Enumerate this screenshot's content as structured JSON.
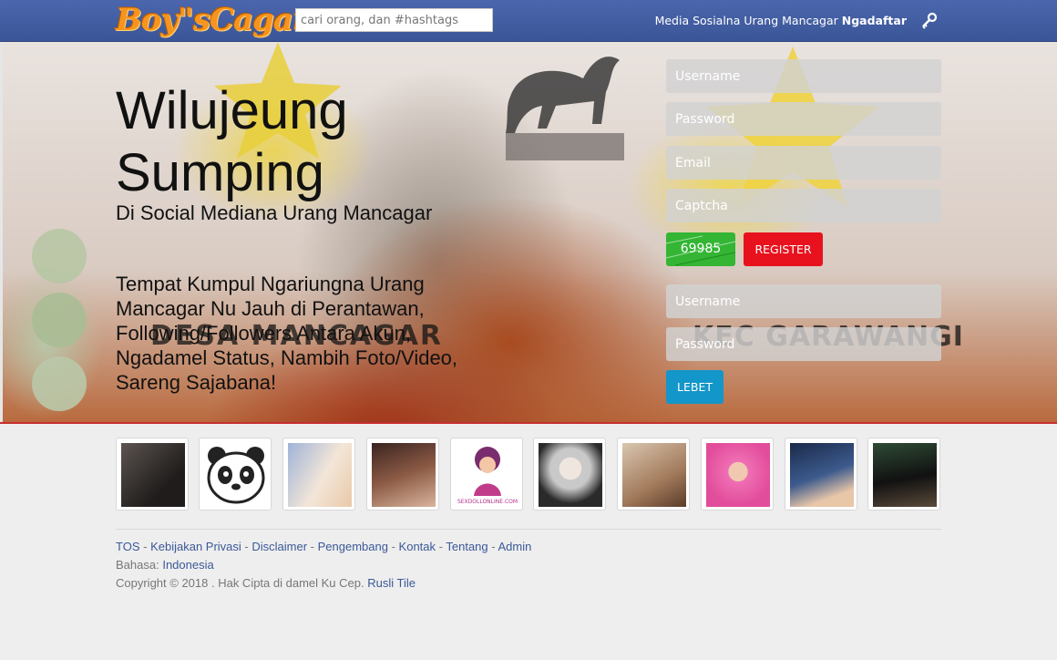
{
  "header": {
    "logo": "Boy\"sCagar",
    "search_placeholder": "cari orang, dan #hashtags",
    "tagline": "Media Sosialna Urang Mancagar",
    "signup_link": "Ngadaftar"
  },
  "hero": {
    "title_line1": "Wilujeung",
    "title_line2": "Sumping",
    "subtitle": "Di Social Mediana Urang Mancagar",
    "description": "Tempat Kumpul Ngariungna Urang Mancagar Nu Jauh di Perantawan, Following/Followers Antara Akun, Ngadamel Status, Nambih Foto/Video, Sareng Sajabana!",
    "banner_text_left": "DESA MANCAGAR",
    "banner_text_right": "KEC GARAWANGI"
  },
  "register": {
    "username_placeholder": "Username",
    "password_placeholder": "Password",
    "email_placeholder": "Email",
    "captcha_placeholder": "Captcha",
    "captcha_code": "69985",
    "register_button": "REGISTER"
  },
  "login": {
    "username_placeholder": "Username",
    "password_placeholder": "Password",
    "login_button": "LEBET"
  },
  "avatars": [
    {
      "label": "",
      "color": "#2d2a28"
    },
    {
      "label": "",
      "color": "#ffffff"
    },
    {
      "label": "",
      "color": "#c9d4ea"
    },
    {
      "label": "",
      "color": "#6b3b2a"
    },
    {
      "label": "SEXDOLLONLINE.COM",
      "color": "#ffffff"
    },
    {
      "label": "",
      "color": "#d8d8d8"
    },
    {
      "label": "",
      "color": "#b6906f"
    },
    {
      "label": "",
      "color": "#e35aa5"
    },
    {
      "label": "",
      "color": "#27365a"
    },
    {
      "label": "",
      "color": "#1d2a1e"
    }
  ],
  "footer": {
    "links": [
      "TOS",
      "Kebijakan Privasi",
      "Disclaimer",
      "Pengembang",
      "Kontak",
      "Tentang",
      "Admin"
    ],
    "language_label": "Bahasa:",
    "language_value": "Indonesia",
    "copyright": "Copyright © 2018 . Hak Cipta di damel Ku Cep.",
    "author": "Rusli Tile"
  },
  "colors": {
    "header_bg": "#3f5a9c",
    "captcha_green": "#34b534",
    "register_red": "#e8121e",
    "login_blue": "#1396c9",
    "link_blue": "#3b5998"
  }
}
